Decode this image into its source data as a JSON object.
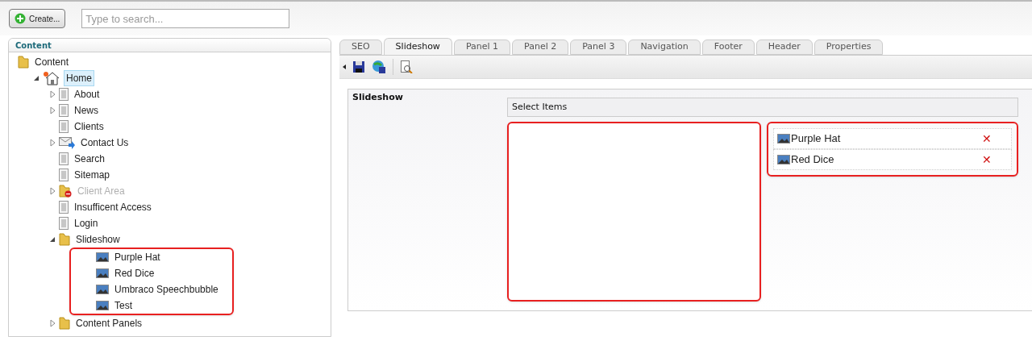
{
  "toolbar": {
    "create_button": "Create...",
    "search": {
      "placeholder": "Type to search..."
    }
  },
  "content_panel": {
    "title": "Content",
    "tree": [
      {
        "label": "Content",
        "kind": "folder",
        "selected": false,
        "disabled": false,
        "children": [
          {
            "label": "Home",
            "kind": "home",
            "expanded": true,
            "selected": true,
            "disabled": false,
            "children": [
              {
                "label": "About",
                "kind": "page",
                "expanded": false,
                "selected": false,
                "disabled": false
              },
              {
                "label": "News",
                "kind": "page",
                "expanded": false,
                "selected": false,
                "disabled": false
              },
              {
                "label": "Clients",
                "kind": "page",
                "selected": false,
                "disabled": false
              },
              {
                "label": "Contact Us",
                "kind": "mail",
                "expanded": false,
                "selected": false,
                "disabled": false
              },
              {
                "label": "Search",
                "kind": "page",
                "selected": false,
                "disabled": false
              },
              {
                "label": "Sitemap",
                "kind": "page",
                "selected": false,
                "disabled": false
              },
              {
                "label": "Client Area",
                "kind": "locked",
                "expanded": false,
                "selected": false,
                "disabled": true
              },
              {
                "label": "Insufficent Access",
                "kind": "page",
                "selected": false,
                "disabled": false
              },
              {
                "label": "Login",
                "kind": "page",
                "selected": false,
                "disabled": false
              },
              {
                "label": "Slideshow",
                "kind": "folder",
                "expanded": true,
                "children_outlined": true,
                "selected": false,
                "disabled": false,
                "children": [
                  {
                    "label": "Purple Hat",
                    "kind": "image",
                    "selected": false,
                    "disabled": false
                  },
                  {
                    "label": "Red Dice",
                    "kind": "image",
                    "selected": false,
                    "disabled": false
                  },
                  {
                    "label": "Umbraco Speechbubble",
                    "kind": "image",
                    "selected": false,
                    "disabled": false
                  },
                  {
                    "label": "Test",
                    "kind": "image",
                    "selected": false,
                    "disabled": false
                  }
                ]
              },
              {
                "label": "Content Panels",
                "kind": "folder",
                "expanded": false,
                "selected": false,
                "disabled": false
              }
            ]
          }
        ]
      }
    ]
  },
  "tabs": [
    {
      "label": "SEO",
      "selected": false
    },
    {
      "label": "Slideshow",
      "selected": true
    },
    {
      "label": "Panel 1",
      "selected": false
    },
    {
      "label": "Panel 2",
      "selected": false
    },
    {
      "label": "Panel 3",
      "selected": false
    },
    {
      "label": "Navigation",
      "selected": false
    },
    {
      "label": "Footer",
      "selected": false
    },
    {
      "label": "Header",
      "selected": false
    },
    {
      "label": "Properties",
      "selected": false
    }
  ],
  "property": {
    "label": "Slideshow",
    "picker_title": "Select Items",
    "available_highlighted": true,
    "selected_highlighted": true,
    "selected_items": [
      {
        "label": "Purple Hat",
        "remove": "✕"
      },
      {
        "label": "Red Dice",
        "remove": "✕"
      }
    ]
  }
}
